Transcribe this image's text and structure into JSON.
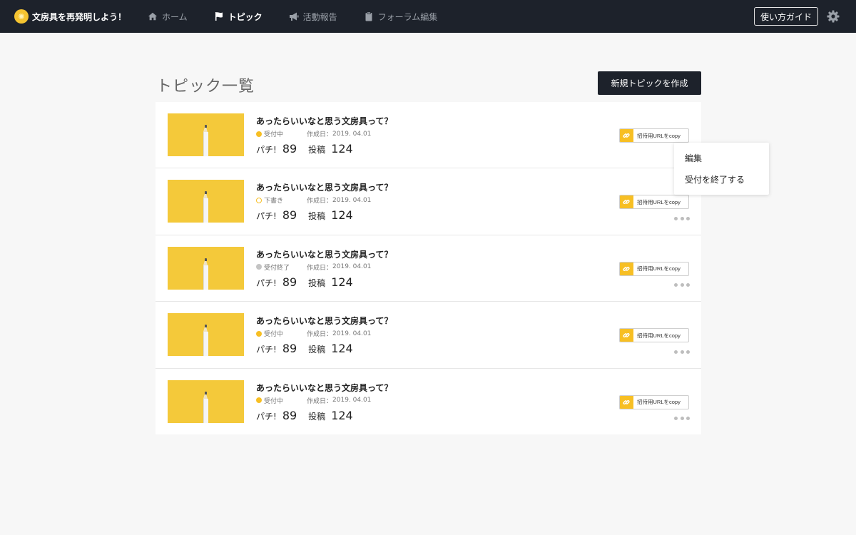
{
  "app": {
    "brand_name": "文房具を再発明しよう！",
    "brand_color": "#f5c431"
  },
  "nav": {
    "items": [
      {
        "label": "ホーム",
        "icon": "home-icon",
        "active": false
      },
      {
        "label": "トピック",
        "icon": "flag-icon",
        "active": true
      },
      {
        "label": "活動報告",
        "icon": "megaphone-icon",
        "active": false
      },
      {
        "label": "フォーラム編集",
        "icon": "clipboard-icon",
        "active": false
      }
    ],
    "guide_label": "使い方ガイド",
    "settings_icon": "gear-icon"
  },
  "page": {
    "title": "トピック一覧",
    "new_topic_label": "新規トピックを作成"
  },
  "labels": {
    "created_prefix": "作成日：",
    "likes_label": "パチ!",
    "posts_label": "投稿",
    "copy_label": "招待用URLをcopy",
    "more_icon": "more-dots-icon"
  },
  "topics": [
    {
      "title": "あったらいいなと思う文房具って？",
      "status": "受付中",
      "status_type": "open",
      "created": "2019. 04.01",
      "likes": "89",
      "posts": "124"
    },
    {
      "title": "あったらいいなと思う文房具って？",
      "status": "下書き",
      "status_type": "draft",
      "created": "2019. 04.01",
      "likes": "89",
      "posts": "124"
    },
    {
      "title": "あったらいいなと思う文房具って？",
      "status": "受付終了",
      "status_type": "closed",
      "created": "2019. 04.01",
      "likes": "89",
      "posts": "124"
    },
    {
      "title": "あったらいいなと思う文房具って？",
      "status": "受付中",
      "status_type": "open",
      "created": "2019. 04.01",
      "likes": "89",
      "posts": "124"
    },
    {
      "title": "あったらいいなと思う文房具って？",
      "status": "受付中",
      "status_type": "open",
      "created": "2019. 04.01",
      "likes": "89",
      "posts": "124"
    }
  ],
  "dropdown": {
    "items": [
      "編集",
      "受付を終了する"
    ]
  },
  "colors": {
    "nav_bg": "#1d222b",
    "accent": "#f7bf24",
    "status_closed": "#c4c4c4",
    "page_bg": "#f7f7f7"
  }
}
